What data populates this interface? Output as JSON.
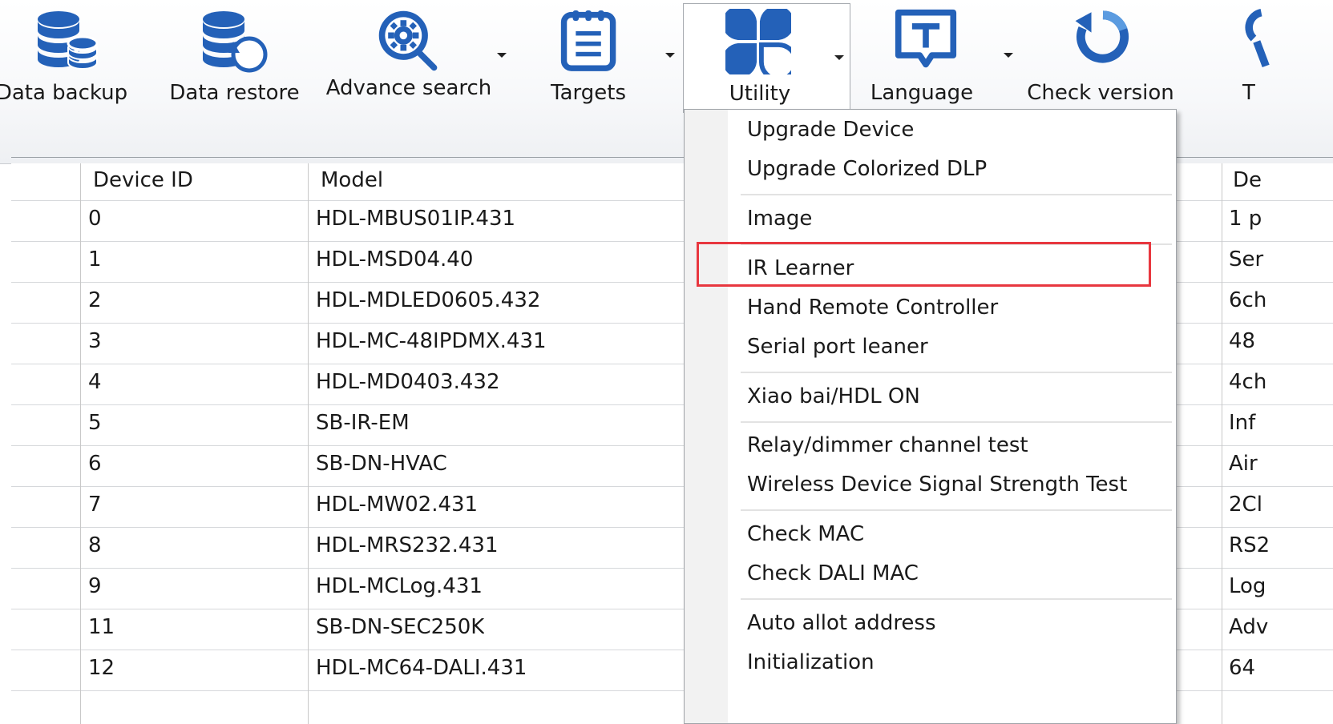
{
  "toolbar": {
    "data_backup": "Data backup",
    "data_restore": "Data restore",
    "advance_search": "Advance search",
    "targets": "Targets",
    "utility": "Utility",
    "language": "Language",
    "check_version": "Check version",
    "clipped_label": "T"
  },
  "table": {
    "headers": [
      "Device ID",
      "Model",
      "De"
    ],
    "rows": [
      {
        "id": "0",
        "model": "HDL-MBUS01IP.431",
        "desc": "1 p"
      },
      {
        "id": "1",
        "model": "HDL-MSD04.40",
        "desc": "Ser"
      },
      {
        "id": "2",
        "model": "HDL-MDLED0605.432",
        "desc": "6ch"
      },
      {
        "id": "3",
        "model": "HDL-MC-48IPDMX.431",
        "desc": "48"
      },
      {
        "id": "4",
        "model": "HDL-MD0403.432",
        "desc": "4ch"
      },
      {
        "id": "5",
        "model": "SB-IR-EM",
        "desc": "Inf"
      },
      {
        "id": "6",
        "model": "SB-DN-HVAC",
        "desc": "Air"
      },
      {
        "id": "7",
        "model": "HDL-MW02.431",
        "desc": "2Cl"
      },
      {
        "id": "8",
        "model": "HDL-MRS232.431",
        "desc": "RS2"
      },
      {
        "id": "9",
        "model": "HDL-MCLog.431",
        "desc": "Log"
      },
      {
        "id": "11",
        "model": "SB-DN-SEC250K",
        "desc": "Adv"
      },
      {
        "id": "12",
        "model": "HDL-MC64-DALI.431",
        "desc": "64"
      }
    ]
  },
  "utility_menu": {
    "items": [
      "Upgrade Device",
      "Upgrade Colorized DLP",
      "Image",
      "IR Learner",
      "Hand Remote Controller",
      "Serial port leaner",
      "Xiao bai/HDL ON",
      "Relay/dimmer channel test",
      "Wireless Device Signal Strength Test",
      "Check MAC",
      "Check DALI MAC",
      "Auto allot address",
      "Initialization"
    ],
    "highlighted": "IR Learner"
  },
  "colors": {
    "icon_blue": "#2461b8",
    "highlight_red": "#e8373f"
  }
}
